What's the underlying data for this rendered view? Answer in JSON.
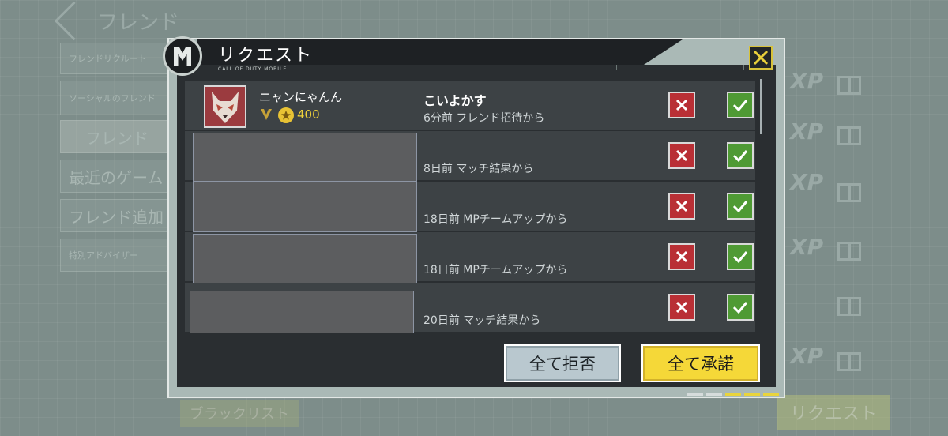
{
  "background": {
    "back_title": "フレンド",
    "side_items": [
      "フレンドリクルート",
      "ソーシャルのフレンド",
      "フレンド",
      "最近のゲーム",
      "フレンド追加",
      "特別アドバイザー"
    ],
    "xp_label": "XP",
    "blacklist_label": "ブラックリスト",
    "request_tab_label": "リクエスト"
  },
  "dialog": {
    "title": "リクエスト",
    "subtitle": "CALL OF DUTY MOBILE",
    "requests": [
      {
        "name": "ニャンにゃんん",
        "level": "400",
        "message": "こいよかす",
        "source": "6分前 フレンド招待から"
      },
      {
        "source": "8日前 マッチ結果から"
      },
      {
        "source": "18日前 MPチームアップから"
      },
      {
        "source": "18日前 MPチームアップから"
      },
      {
        "source": "20日前 マッチ結果から"
      }
    ],
    "reject_all_label": "全て拒否",
    "accept_all_label": "全て承諾"
  },
  "colors": {
    "accent_yellow": "#f5d838",
    "reject_red": "#b92f35",
    "accept_green": "#4f9a34",
    "panel_dark": "#2a2e31"
  }
}
